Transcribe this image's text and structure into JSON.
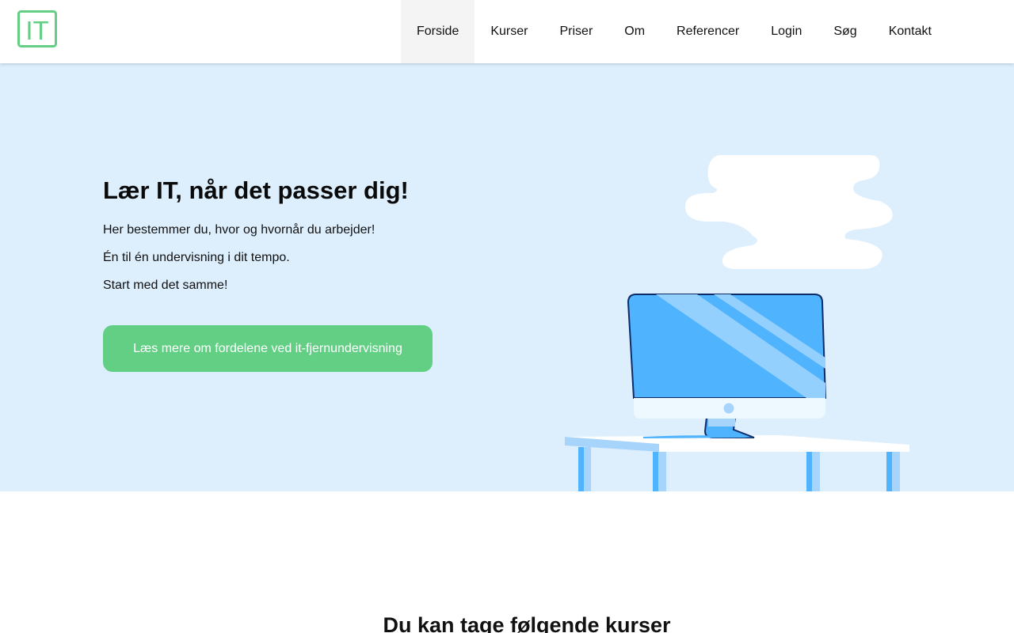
{
  "header": {
    "logo_text": "IT",
    "nav": [
      {
        "label": "Forside",
        "active": true
      },
      {
        "label": "Kurser",
        "active": false
      },
      {
        "label": "Priser",
        "active": false
      },
      {
        "label": "Om",
        "active": false
      },
      {
        "label": "Referencer",
        "active": false
      },
      {
        "label": "Login",
        "active": false
      },
      {
        "label": "Søg",
        "active": false
      },
      {
        "label": "Kontakt",
        "active": false
      }
    ]
  },
  "hero": {
    "title": "Lær IT, når det passer dig!",
    "lines": [
      "Her bestemmer du, hvor og hvornår du arbejder!",
      "Én til én undervisning i dit tempo.",
      "Start med det samme!"
    ],
    "cta_label": "Læs mere om fordelene ved it-fjernundervisning",
    "illustration_icon": "desktop-computer-on-desk-icon"
  },
  "courses": {
    "title": "Du kan tage følgende kurser"
  },
  "colors": {
    "brand_green": "#63cf85",
    "hero_bg": "#ddeefd",
    "screen_blue": "#4fb3fd"
  }
}
